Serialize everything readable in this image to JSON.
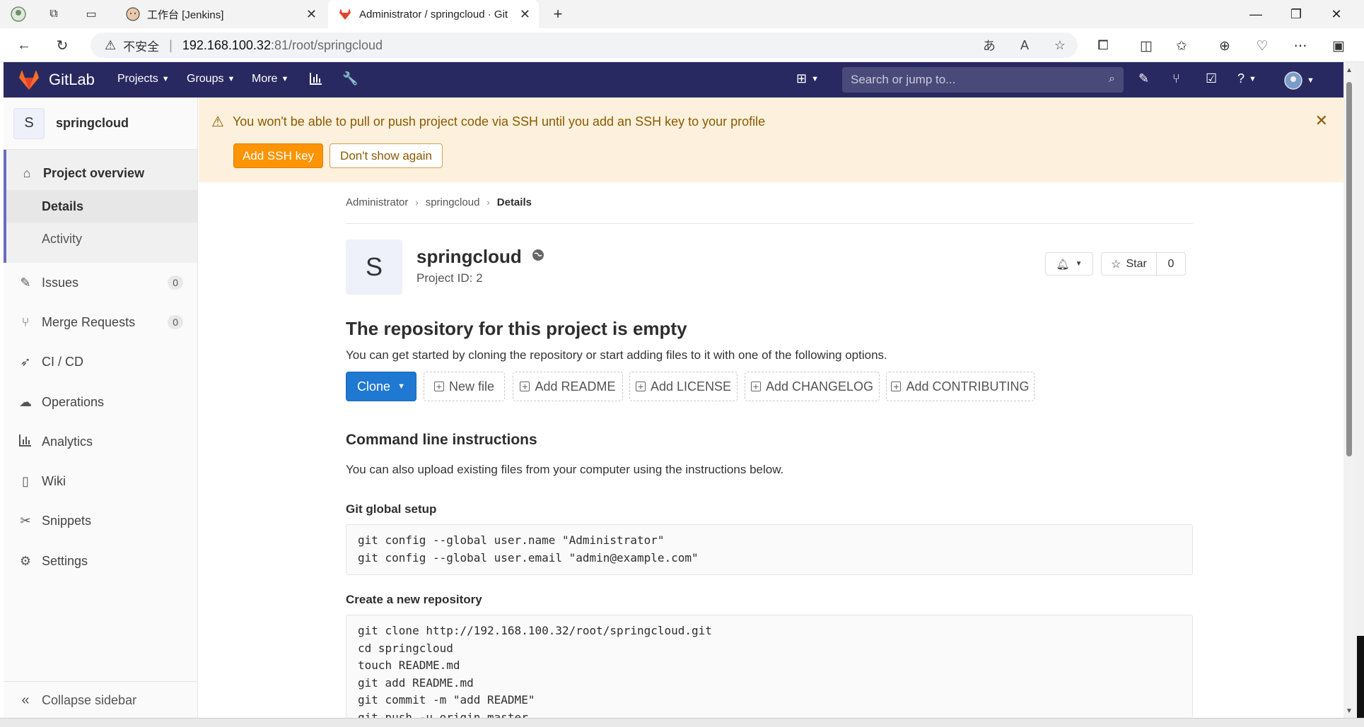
{
  "browser": {
    "tabs": [
      {
        "title": "工作台 [Jenkins]"
      },
      {
        "title": "Administrator / springcloud · Git"
      }
    ],
    "url": {
      "insecure_label": "不安全",
      "host": "192.168.100.32",
      "path": ":81/root/springcloud"
    }
  },
  "gitlab_nav": {
    "brand": "GitLab",
    "menus": [
      "Projects",
      "Groups",
      "More"
    ],
    "search_placeholder": "Search or jump to..."
  },
  "sidebar": {
    "project_initial": "S",
    "project_name": "springcloud",
    "overview_label": "Project overview",
    "overview_sub": [
      "Details",
      "Activity"
    ],
    "items": [
      {
        "label": "Issues",
        "count": "0",
        "icon": "issues-icon"
      },
      {
        "label": "Merge Requests",
        "count": "0",
        "icon": "merge-request-icon"
      },
      {
        "label": "CI / CD",
        "icon": "rocket-icon"
      },
      {
        "label": "Operations",
        "icon": "cloud-gear-icon"
      },
      {
        "label": "Analytics",
        "icon": "chart-icon"
      },
      {
        "label": "Wiki",
        "icon": "book-icon"
      },
      {
        "label": "Snippets",
        "icon": "scissors-icon"
      },
      {
        "label": "Settings",
        "icon": "gear-icon"
      }
    ],
    "collapse_label": "Collapse sidebar"
  },
  "alert": {
    "message": "You won't be able to pull or push project code via SSH until you add an SSH key to your profile",
    "primary_button": "Add SSH key",
    "secondary_button": "Don't show again"
  },
  "breadcrumb": [
    "Administrator",
    "springcloud",
    "Details"
  ],
  "project": {
    "initial": "S",
    "name": "springcloud",
    "id_text": "Project ID: 2",
    "star_label": "Star",
    "star_count": "0"
  },
  "empty_repo": {
    "heading": "The repository for this project is empty",
    "text": "You can get started by cloning the repository or start adding files to it with one of the following options.",
    "clone_label": "Clone",
    "buttons": [
      "New file",
      "Add README",
      "Add LICENSE",
      "Add CHANGELOG",
      "Add CONTRIBUTING"
    ]
  },
  "cli": {
    "heading": "Command line instructions",
    "text": "You can also upload existing files from your computer using the instructions below.",
    "git_global_title": "Git global setup",
    "git_global_lines": [
      "git config --global user.name \"Administrator\"",
      "git config --global user.email \"admin@example.com\""
    ],
    "new_repo_title": "Create a new repository",
    "new_repo_lines": [
      "git clone http://192.168.100.32/root/springcloud.git",
      "cd springcloud",
      "touch README.md",
      "git add README.md",
      "git commit -m \"add README\"",
      "git push -u origin master"
    ]
  },
  "colors": {
    "navbar": "#292961",
    "accent": "#6b6bc1",
    "alert_bg": "#fdf1dd",
    "warning_button": "#fc9403",
    "primary_button": "#1f78d1"
  }
}
